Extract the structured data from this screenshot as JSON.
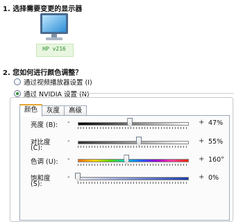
{
  "step1": {
    "title": "1. 选择需要变更的显示器"
  },
  "monitor": {
    "name": "HP v216"
  },
  "step2": {
    "title": "2. 您如何进行颜色调整？"
  },
  "options": [
    {
      "label": "通过视频播放器设置 (I)",
      "checked": false
    },
    {
      "label": "通过 NVIDIA 设置 (N)",
      "checked": true
    }
  ],
  "tabs": [
    {
      "label": "颜色",
      "active": true
    },
    {
      "label": "灰度",
      "active": false
    },
    {
      "label": "高级",
      "active": false
    }
  ],
  "sliders": [
    {
      "label": "亮度 (B):",
      "minus": "-",
      "plus": "+",
      "value": "47%",
      "level": 0.47,
      "style": "gray"
    },
    {
      "label_line1": "对比度",
      "label_line2": "(C):",
      "minus": "-",
      "plus": "+",
      "value": "55%",
      "level": 0.55,
      "style": "gray"
    },
    {
      "label": "色调 (U):",
      "minus": "-",
      "plus": "+",
      "value": "160°",
      "level": 0.44,
      "style": "rainbow"
    },
    {
      "label_line1": "饱和度",
      "label_line2": "(S):",
      "minus": "-",
      "plus": "+",
      "value": "0%",
      "level": 0.0,
      "style": "blue"
    }
  ],
  "colors": {
    "accent_tab": "#e5a630",
    "monitor_name": "#2a8a2a"
  }
}
